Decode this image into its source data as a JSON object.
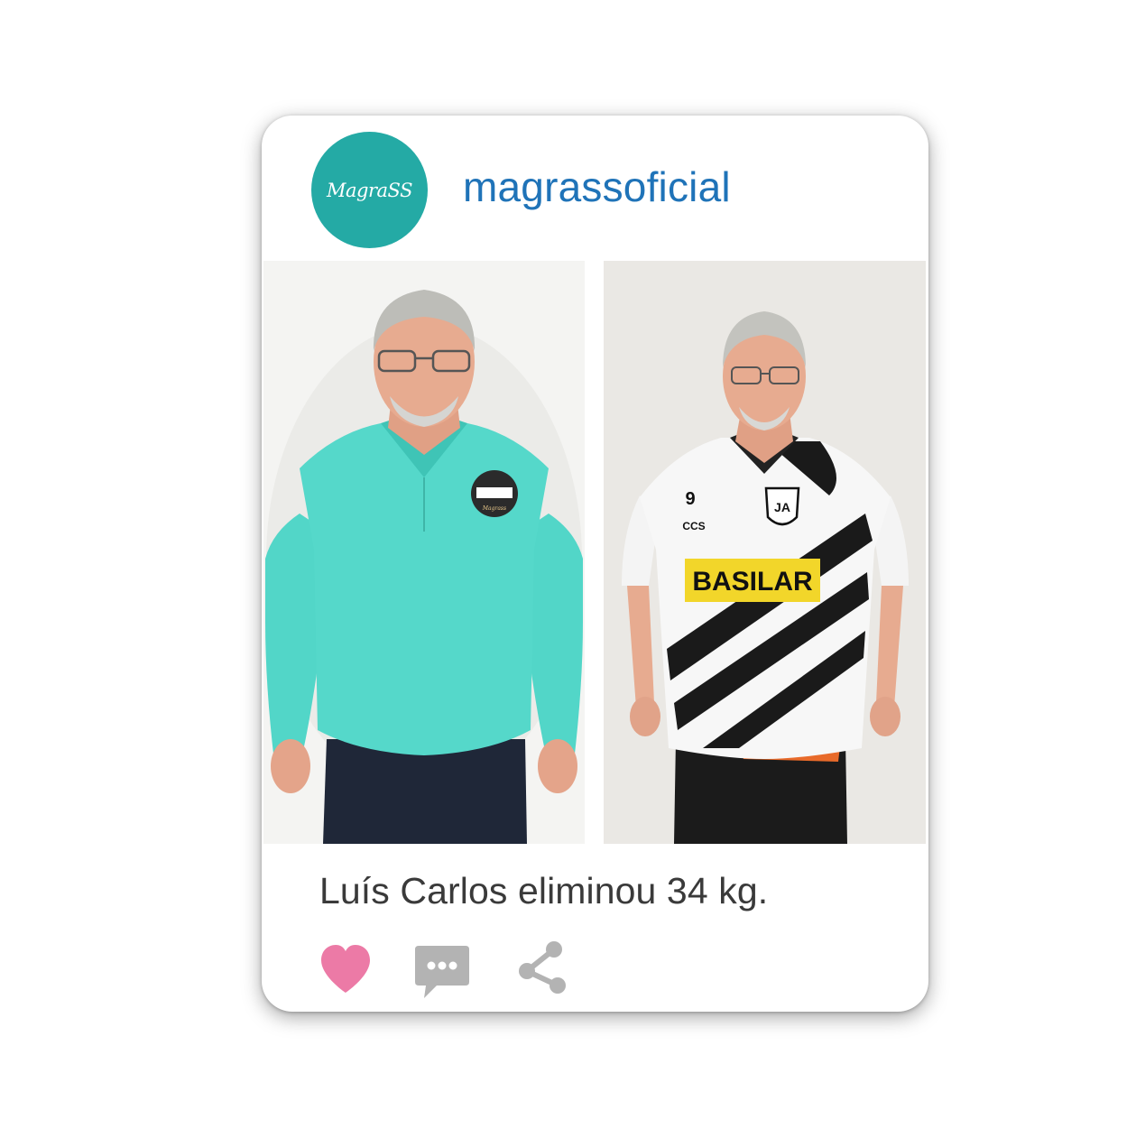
{
  "post": {
    "username": "magrassoficial",
    "avatar_logo": "MagraSS",
    "caption": "Luís Carlos eliminou 34 kg.",
    "photos": [
      {
        "kind": "before",
        "badge_text": "Magrass",
        "shirt_color": "#4fd3c4"
      },
      {
        "kind": "after",
        "jersey_number": "9",
        "jersey_brand": "CCS",
        "jersey_crest": "JA",
        "jersey_sponsor": "BASILAR"
      }
    ]
  },
  "actions": [
    {
      "name": "like",
      "icon": "heart-icon",
      "color": "#ec7aa6"
    },
    {
      "name": "comment",
      "icon": "comment-icon",
      "color": "#b3b3b3"
    },
    {
      "name": "share",
      "icon": "share-icon",
      "color": "#b3b3b3"
    }
  ],
  "colors": {
    "brand_teal": "#24aaa5",
    "username_blue": "#1f73b8"
  }
}
